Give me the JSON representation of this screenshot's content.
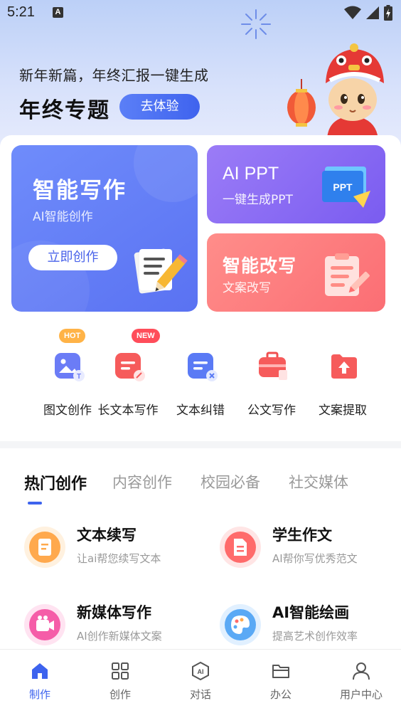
{
  "status_bar": {
    "time": "5:21",
    "notification_letter": "A",
    "icons": [
      "wifi-icon",
      "signal-icon",
      "battery-charging-icon"
    ]
  },
  "banner": {
    "subtitle": "新年新篇，年终汇报一键生成",
    "title": "年终专题",
    "button": "去体验"
  },
  "cards": {
    "write": {
      "title": "智能写作",
      "subtitle": "AI智能创作",
      "button": "立即创作",
      "icon": "paper-pencil-icon"
    },
    "ppt": {
      "title": "AI PPT",
      "subtitle": "一键生成PPT",
      "icon": "ppt-icon",
      "icon_text": "PPT"
    },
    "rewrite": {
      "title": "智能改写",
      "subtitle": "文案改写",
      "icon": "clipboard-edit-icon"
    }
  },
  "tools": [
    {
      "label": "图文创作",
      "badge": "HOT",
      "icon": "image-text-icon"
    },
    {
      "label": "长文本写作",
      "badge": "NEW",
      "icon": "long-text-icon"
    },
    {
      "label": "文本纠错",
      "badge": "",
      "icon": "text-correct-icon"
    },
    {
      "label": "公文写作",
      "badge": "",
      "icon": "briefcase-icon"
    },
    {
      "label": "文案提取",
      "badge": "",
      "icon": "folder-upload-icon"
    }
  ],
  "tabs": [
    {
      "label": "热门创作",
      "active": true
    },
    {
      "label": "内容创作",
      "active": false
    },
    {
      "label": "校园必备",
      "active": false
    },
    {
      "label": "社交媒体",
      "active": false
    }
  ],
  "features": [
    {
      "title": "文本续写",
      "desc": "让ai帮您续写文本",
      "icon": "continue-writing-icon",
      "color": "#ffa94d"
    },
    {
      "title": "学生作文",
      "desc": "AI帮你写优秀范文",
      "icon": "essay-icon",
      "color": "#ff6b6b"
    },
    {
      "title": "新媒体写作",
      "desc": "AI创作新媒体文案",
      "icon": "video-camera-icon",
      "color": "#f55da8"
    },
    {
      "title": "AI智能绘画",
      "desc": "提高艺术创作效率",
      "icon": "palette-icon",
      "color": "#5aa9f5"
    }
  ],
  "bottom_nav": [
    {
      "label": "制作",
      "icon": "home-icon",
      "active": true
    },
    {
      "label": "创作",
      "icon": "grid-icon",
      "active": false
    },
    {
      "label": "对话",
      "icon": "ai-chat-icon",
      "active": false
    },
    {
      "label": "办公",
      "icon": "folder-icon",
      "active": false
    },
    {
      "label": "用户中心",
      "icon": "user-icon",
      "active": false
    }
  ],
  "colors": {
    "primary": "#3d63ee",
    "write_card": "#6080f7",
    "ppt_card": "#8a6cf4",
    "rewrite_card": "#fd7c7f",
    "hot_badge": "#ffb347",
    "new_badge": "#ff4d5a"
  }
}
